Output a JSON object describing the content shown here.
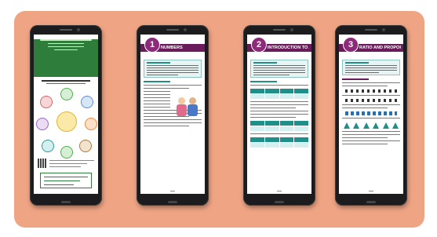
{
  "banner": {
    "background": "#efa584"
  },
  "phones": [
    {
      "kind": "cover",
      "theme": "#2e7d3b"
    },
    {
      "kind": "chapter",
      "chapter_number": "1",
      "chapter_title": "NUMBERS",
      "accent": "#6a1b5a",
      "box": "#8bc5c2"
    },
    {
      "kind": "chapter",
      "chapter_number": "2",
      "chapter_title": "INTRODUCTION TO ALGEBRA",
      "accent": "#6a1b5a",
      "box": "#8bc5c2"
    },
    {
      "kind": "chapter",
      "chapter_number": "3",
      "chapter_title": "RATIO AND PROPORTION",
      "accent": "#6a1b5a",
      "box": "#8bc5c2"
    }
  ]
}
